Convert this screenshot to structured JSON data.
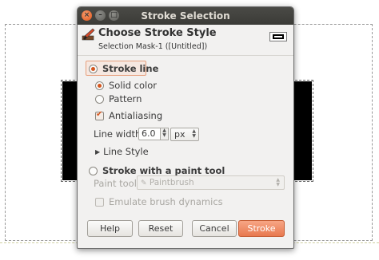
{
  "dialog": {
    "title": "Stroke Selection",
    "header_title": "Choose Stroke Style",
    "header_subtitle": "Selection Mask-1 ([Untitled])"
  },
  "stroke_line": {
    "label": "Stroke line",
    "selected": true,
    "solid_color": {
      "label": "Solid color",
      "selected": true
    },
    "pattern": {
      "label": "Pattern",
      "selected": false
    },
    "antialiasing": {
      "label": "Antialiasing",
      "checked": true
    },
    "line_width": {
      "label": "Line width:",
      "value": "6.0",
      "unit": "px"
    },
    "line_style": {
      "label": "Line Style"
    }
  },
  "paint_tool_option": {
    "label": "Stroke with a paint tool",
    "selected": false,
    "paint_tool_label": "Paint tool:",
    "paint_tool_value": "Paintbrush",
    "emulate_label": "Emulate brush dynamics",
    "emulate_checked": false
  },
  "buttons": {
    "help": "Help",
    "reset": "Reset",
    "cancel": "Cancel",
    "stroke": "Stroke"
  },
  "colors": {
    "accent": "#e8794f",
    "titlebar": "#3c3b37"
  }
}
